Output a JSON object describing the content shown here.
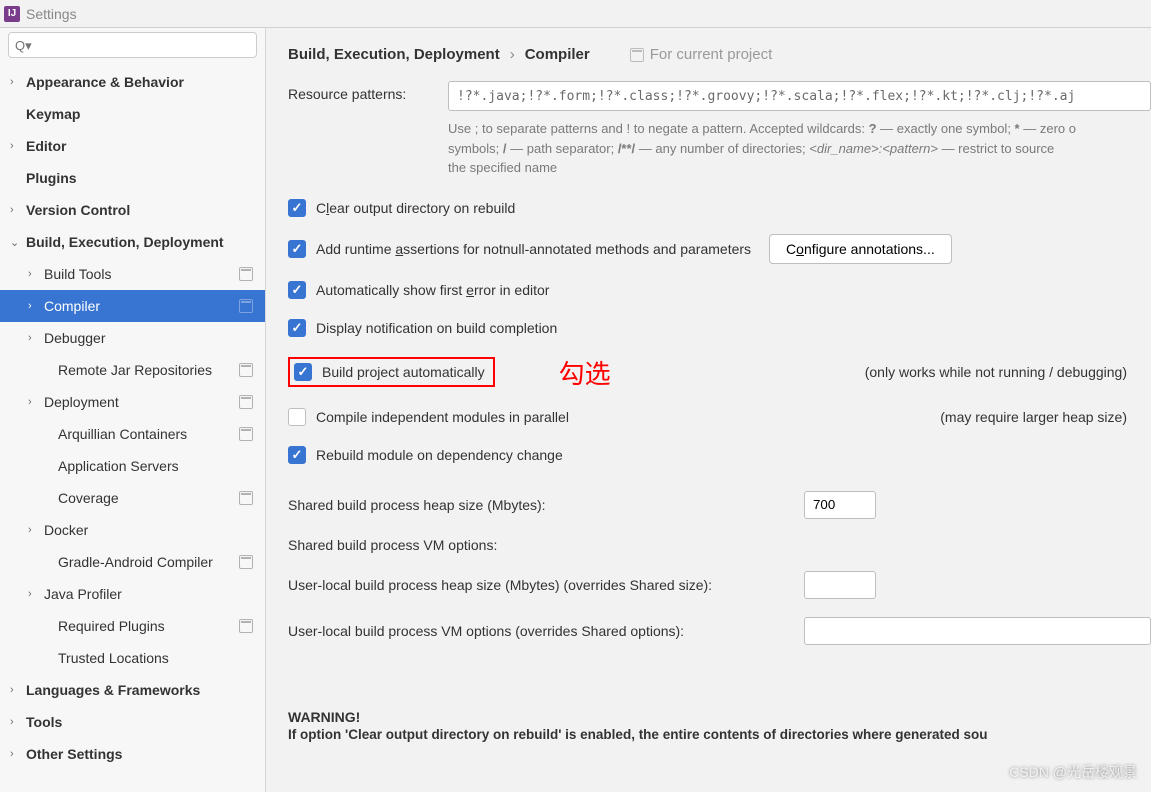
{
  "window": {
    "title": "Settings"
  },
  "search": {
    "placeholder": "Q▾"
  },
  "sidebar": {
    "items": [
      {
        "label": "Appearance & Behavior",
        "chev": "›",
        "bold": true,
        "level": 0
      },
      {
        "label": "Keymap",
        "chev": "",
        "bold": true,
        "level": 0
      },
      {
        "label": "Editor",
        "chev": "›",
        "bold": true,
        "level": 0
      },
      {
        "label": "Plugins",
        "chev": "",
        "bold": true,
        "level": 0
      },
      {
        "label": "Version Control",
        "chev": "›",
        "bold": true,
        "level": 0
      },
      {
        "label": "Build, Execution, Deployment",
        "chev": "⌄",
        "bold": true,
        "level": 0
      },
      {
        "label": "Build Tools",
        "chev": "›",
        "bold": false,
        "level": 1,
        "proj": true
      },
      {
        "label": "Compiler",
        "chev": "›",
        "bold": false,
        "level": 1,
        "proj": true,
        "selected": true
      },
      {
        "label": "Debugger",
        "chev": "›",
        "bold": false,
        "level": 1
      },
      {
        "label": "Remote Jar Repositories",
        "chev": "",
        "bold": false,
        "level": 2,
        "proj": true
      },
      {
        "label": "Deployment",
        "chev": "›",
        "bold": false,
        "level": 1,
        "proj": true
      },
      {
        "label": "Arquillian Containers",
        "chev": "",
        "bold": false,
        "level": 2,
        "proj": true
      },
      {
        "label": "Application Servers",
        "chev": "",
        "bold": false,
        "level": 2
      },
      {
        "label": "Coverage",
        "chev": "",
        "bold": false,
        "level": 2,
        "proj": true
      },
      {
        "label": "Docker",
        "chev": "›",
        "bold": false,
        "level": 1
      },
      {
        "label": "Gradle-Android Compiler",
        "chev": "",
        "bold": false,
        "level": 2,
        "proj": true
      },
      {
        "label": "Java Profiler",
        "chev": "›",
        "bold": false,
        "level": 1
      },
      {
        "label": "Required Plugins",
        "chev": "",
        "bold": false,
        "level": 2,
        "proj": true
      },
      {
        "label": "Trusted Locations",
        "chev": "",
        "bold": false,
        "level": 2
      },
      {
        "label": "Languages & Frameworks",
        "chev": "›",
        "bold": true,
        "level": 0
      },
      {
        "label": "Tools",
        "chev": "›",
        "bold": true,
        "level": 0
      },
      {
        "label": "Other Settings",
        "chev": "›",
        "bold": true,
        "level": 0
      }
    ]
  },
  "breadcrumb": {
    "part1": "Build, Execution, Deployment",
    "sep": "›",
    "part2": "Compiler",
    "project_hint": "For current project"
  },
  "resource": {
    "label": "Resource patterns:",
    "value": "!?*.java;!?*.form;!?*.class;!?*.groovy;!?*.scala;!?*.flex;!?*.kt;!?*.clj;!?*.aj",
    "help_a": "Use ; to separate patterns and ! to negate a pattern. Accepted wildcards: ",
    "help_b": " — exactly one symbol; ",
    "help_c": " — zero o",
    "help_d": "symbols; ",
    "help_e": " — path separator; ",
    "help_f": " — any number of directories; ",
    "help_g": " — restrict to source",
    "help_h": "the specified name",
    "q": "?",
    "star": "*",
    "slash": "/",
    "dblstar": "/**/",
    "dirpat": "<dir_name>:<pattern>"
  },
  "checks": {
    "clear_output": "Clear output directory on rebuild",
    "add_runtime_pre": "Add runtime ",
    "add_runtime_u": "a",
    "add_runtime_post": "ssertions for notnull-annotated methods and parameters",
    "configure_btn_pre": "C",
    "configure_btn_u": "o",
    "configure_btn_post": "nfigure annotations...",
    "auto_error_pre": "Automatically show first ",
    "auto_error_u": "e",
    "auto_error_post": "rror in editor",
    "display_notif": "Display notification on build completion",
    "build_auto": "Build project automatically",
    "annotation": "勾选",
    "build_auto_note": "(only works while not running / debugging)",
    "compile_parallel": "Compile independent modules in parallel",
    "compile_parallel_note": "(may require larger heap size)",
    "rebuild_module": "Rebuild module on dependency change"
  },
  "settings": {
    "heap_size_label": "Shared build process heap size (Mbytes):",
    "heap_size_value": "700",
    "vm_options_label": "Shared build process VM options:",
    "user_heap_label": "User-local build process heap size (Mbytes) (overrides Shared size):",
    "user_vm_label": "User-local build process VM options (overrides Shared options):"
  },
  "warning": {
    "title": "WARNING!",
    "body": "If option 'Clear output directory on rebuild' is enabled, the entire contents of directories where generated sou"
  },
  "watermark": "CSDN @光岳楼观景"
}
